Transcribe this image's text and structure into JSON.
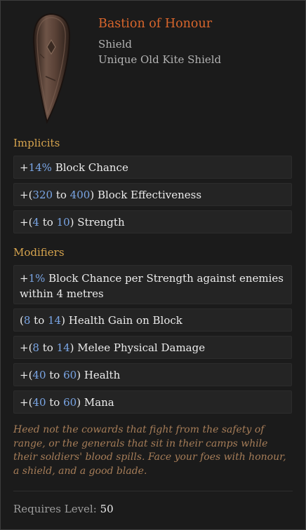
{
  "item": {
    "name": "Bastion of Honour",
    "type": "Shield",
    "base": "Unique Old Kite Shield",
    "icon": "kite-shield-icon",
    "name_color": "#d9662c"
  },
  "implicits": {
    "title": "Implicits",
    "rows": [
      {
        "p1": "+",
        "v1": "14%",
        "p2": "",
        "v2": "",
        "p3": "",
        "text": " Block Chance"
      },
      {
        "p1": "+(",
        "v1": "320",
        "p2": " to ",
        "v2": "400",
        "p3": ")",
        "text": " Block Effectiveness"
      },
      {
        "p1": "+(",
        "v1": "4",
        "p2": " to ",
        "v2": "10",
        "p3": ")",
        "text": " Strength"
      }
    ]
  },
  "modifiers": {
    "title": "Modifiers",
    "rows": [
      {
        "p1": "+",
        "v1": "1%",
        "p2": "",
        "v2": "",
        "p3": "",
        "text": " Block Chance per Strength against enemies within 4 metres"
      },
      {
        "p1": "(",
        "v1": "8",
        "p2": " to ",
        "v2": "14",
        "p3": ")",
        "text": " Health Gain on Block"
      },
      {
        "p1": "+(",
        "v1": "8",
        "p2": " to ",
        "v2": "14",
        "p3": ")",
        "text": " Melee Physical Damage"
      },
      {
        "p1": "+(",
        "v1": "40",
        "p2": " to ",
        "v2": "60",
        "p3": ")",
        "text": " Health"
      },
      {
        "p1": "+(",
        "v1": "40",
        "p2": " to ",
        "v2": "60",
        "p3": ")",
        "text": " Mana"
      }
    ]
  },
  "lore": "Heed not the cowards that fight from the safety of range, or the generals that sit in their camps while their soldiers' blood spills. Face your foes with honour, a shield, and a good blade.",
  "requirement": {
    "label": "Requires Level: ",
    "level": "50"
  },
  "colors": {
    "value_blue": "#7aa6e6",
    "section_gold": "#d6a44e",
    "lore_brown": "#a67d58"
  }
}
